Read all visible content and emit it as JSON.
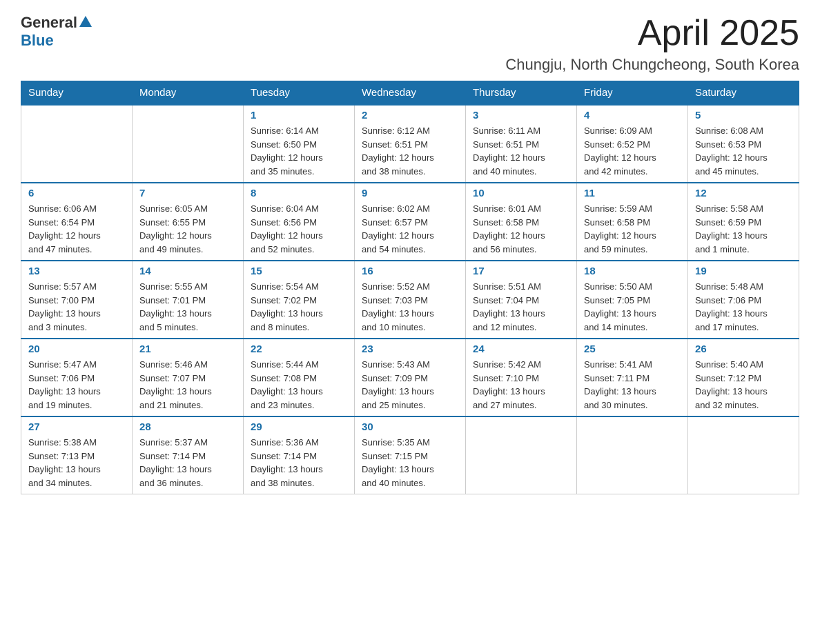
{
  "logo": {
    "general": "General",
    "blue": "Blue"
  },
  "header": {
    "month": "April 2025",
    "location": "Chungju, North Chungcheong, South Korea"
  },
  "weekdays": [
    "Sunday",
    "Monday",
    "Tuesday",
    "Wednesday",
    "Thursday",
    "Friday",
    "Saturday"
  ],
  "weeks": [
    [
      {
        "day": "",
        "info": ""
      },
      {
        "day": "",
        "info": ""
      },
      {
        "day": "1",
        "info": "Sunrise: 6:14 AM\nSunset: 6:50 PM\nDaylight: 12 hours\nand 35 minutes."
      },
      {
        "day": "2",
        "info": "Sunrise: 6:12 AM\nSunset: 6:51 PM\nDaylight: 12 hours\nand 38 minutes."
      },
      {
        "day": "3",
        "info": "Sunrise: 6:11 AM\nSunset: 6:51 PM\nDaylight: 12 hours\nand 40 minutes."
      },
      {
        "day": "4",
        "info": "Sunrise: 6:09 AM\nSunset: 6:52 PM\nDaylight: 12 hours\nand 42 minutes."
      },
      {
        "day": "5",
        "info": "Sunrise: 6:08 AM\nSunset: 6:53 PM\nDaylight: 12 hours\nand 45 minutes."
      }
    ],
    [
      {
        "day": "6",
        "info": "Sunrise: 6:06 AM\nSunset: 6:54 PM\nDaylight: 12 hours\nand 47 minutes."
      },
      {
        "day": "7",
        "info": "Sunrise: 6:05 AM\nSunset: 6:55 PM\nDaylight: 12 hours\nand 49 minutes."
      },
      {
        "day": "8",
        "info": "Sunrise: 6:04 AM\nSunset: 6:56 PM\nDaylight: 12 hours\nand 52 minutes."
      },
      {
        "day": "9",
        "info": "Sunrise: 6:02 AM\nSunset: 6:57 PM\nDaylight: 12 hours\nand 54 minutes."
      },
      {
        "day": "10",
        "info": "Sunrise: 6:01 AM\nSunset: 6:58 PM\nDaylight: 12 hours\nand 56 minutes."
      },
      {
        "day": "11",
        "info": "Sunrise: 5:59 AM\nSunset: 6:58 PM\nDaylight: 12 hours\nand 59 minutes."
      },
      {
        "day": "12",
        "info": "Sunrise: 5:58 AM\nSunset: 6:59 PM\nDaylight: 13 hours\nand 1 minute."
      }
    ],
    [
      {
        "day": "13",
        "info": "Sunrise: 5:57 AM\nSunset: 7:00 PM\nDaylight: 13 hours\nand 3 minutes."
      },
      {
        "day": "14",
        "info": "Sunrise: 5:55 AM\nSunset: 7:01 PM\nDaylight: 13 hours\nand 5 minutes."
      },
      {
        "day": "15",
        "info": "Sunrise: 5:54 AM\nSunset: 7:02 PM\nDaylight: 13 hours\nand 8 minutes."
      },
      {
        "day": "16",
        "info": "Sunrise: 5:52 AM\nSunset: 7:03 PM\nDaylight: 13 hours\nand 10 minutes."
      },
      {
        "day": "17",
        "info": "Sunrise: 5:51 AM\nSunset: 7:04 PM\nDaylight: 13 hours\nand 12 minutes."
      },
      {
        "day": "18",
        "info": "Sunrise: 5:50 AM\nSunset: 7:05 PM\nDaylight: 13 hours\nand 14 minutes."
      },
      {
        "day": "19",
        "info": "Sunrise: 5:48 AM\nSunset: 7:06 PM\nDaylight: 13 hours\nand 17 minutes."
      }
    ],
    [
      {
        "day": "20",
        "info": "Sunrise: 5:47 AM\nSunset: 7:06 PM\nDaylight: 13 hours\nand 19 minutes."
      },
      {
        "day": "21",
        "info": "Sunrise: 5:46 AM\nSunset: 7:07 PM\nDaylight: 13 hours\nand 21 minutes."
      },
      {
        "day": "22",
        "info": "Sunrise: 5:44 AM\nSunset: 7:08 PM\nDaylight: 13 hours\nand 23 minutes."
      },
      {
        "day": "23",
        "info": "Sunrise: 5:43 AM\nSunset: 7:09 PM\nDaylight: 13 hours\nand 25 minutes."
      },
      {
        "day": "24",
        "info": "Sunrise: 5:42 AM\nSunset: 7:10 PM\nDaylight: 13 hours\nand 27 minutes."
      },
      {
        "day": "25",
        "info": "Sunrise: 5:41 AM\nSunset: 7:11 PM\nDaylight: 13 hours\nand 30 minutes."
      },
      {
        "day": "26",
        "info": "Sunrise: 5:40 AM\nSunset: 7:12 PM\nDaylight: 13 hours\nand 32 minutes."
      }
    ],
    [
      {
        "day": "27",
        "info": "Sunrise: 5:38 AM\nSunset: 7:13 PM\nDaylight: 13 hours\nand 34 minutes."
      },
      {
        "day": "28",
        "info": "Sunrise: 5:37 AM\nSunset: 7:14 PM\nDaylight: 13 hours\nand 36 minutes."
      },
      {
        "day": "29",
        "info": "Sunrise: 5:36 AM\nSunset: 7:14 PM\nDaylight: 13 hours\nand 38 minutes."
      },
      {
        "day": "30",
        "info": "Sunrise: 5:35 AM\nSunset: 7:15 PM\nDaylight: 13 hours\nand 40 minutes."
      },
      {
        "day": "",
        "info": ""
      },
      {
        "day": "",
        "info": ""
      },
      {
        "day": "",
        "info": ""
      }
    ]
  ]
}
